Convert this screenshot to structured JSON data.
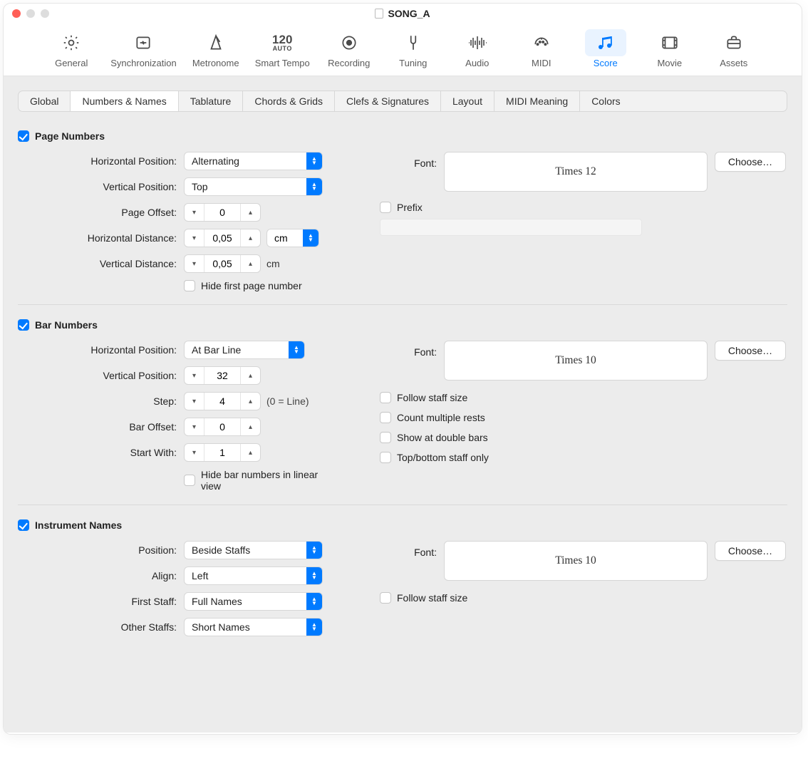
{
  "title": "SONG_A",
  "toolbar": [
    {
      "label": "General"
    },
    {
      "label": "Synchronization"
    },
    {
      "label": "Metronome"
    },
    {
      "label": "Smart Tempo",
      "num": "120",
      "auto": "AUTO"
    },
    {
      "label": "Recording"
    },
    {
      "label": "Tuning"
    },
    {
      "label": "Audio"
    },
    {
      "label": "MIDI"
    },
    {
      "label": "Score"
    },
    {
      "label": "Movie"
    },
    {
      "label": "Assets"
    }
  ],
  "tabs": [
    "Global",
    "Numbers & Names",
    "Tablature",
    "Chords & Grids",
    "Clefs & Signatures",
    "Layout",
    "MIDI Meaning",
    "Colors"
  ],
  "page": {
    "title": "Page Numbers",
    "hpos_lbl": "Horizontal Position:",
    "hpos_val": "Alternating",
    "vpos_lbl": "Vertical Position:",
    "vpos_val": "Top",
    "poff_lbl": "Page Offset:",
    "poff_val": "0",
    "hdist_lbl": "Horizontal Distance:",
    "hdist_val": "0,05",
    "hdist_unit": "cm",
    "vdist_lbl": "Vertical Distance:",
    "vdist_val": "0,05",
    "vdist_unit": "cm",
    "hide_lbl": "Hide first page number",
    "font_lbl": "Font:",
    "font_val": "Times 12",
    "choose": "Choose…",
    "prefix_lbl": "Prefix"
  },
  "bar": {
    "title": "Bar Numbers",
    "hpos_lbl": "Horizontal Position:",
    "hpos_val": "At Bar Line",
    "vpos_lbl": "Vertical Position:",
    "vpos_val": "32",
    "step_lbl": "Step:",
    "step_val": "4",
    "step_note": "(0 = Line)",
    "boff_lbl": "Bar Offset:",
    "boff_val": "0",
    "start_lbl": "Start With:",
    "start_val": "1",
    "hide_lbl": "Hide bar numbers in linear view",
    "font_lbl": "Font:",
    "font_val": "Times 10",
    "choose": "Choose…",
    "follow_lbl": "Follow staff size",
    "count_lbl": "Count multiple rests",
    "double_lbl": "Show at double bars",
    "topbot_lbl": "Top/bottom staff only"
  },
  "inst": {
    "title": "Instrument Names",
    "pos_lbl": "Position:",
    "pos_val": "Beside Staffs",
    "align_lbl": "Align:",
    "align_val": "Left",
    "first_lbl": "First Staff:",
    "first_val": "Full Names",
    "other_lbl": "Other Staffs:",
    "other_val": "Short Names",
    "font_lbl": "Font:",
    "font_val": "Times 10",
    "choose": "Choose…",
    "follow_lbl": "Follow staff size"
  }
}
